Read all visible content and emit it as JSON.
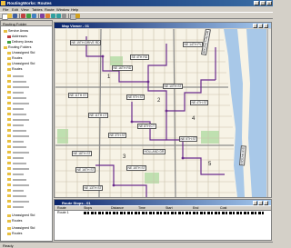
{
  "window": {
    "title": "RoutingWorks: Routes"
  },
  "menu": [
    "File",
    "Edit",
    "View",
    "Tables",
    "Route",
    "Window",
    "Help"
  ],
  "left_pane": {
    "header": "Routing Folder",
    "items": [
      {
        "label": "Service Areas",
        "indent": 1,
        "icon": "folder-icon"
      },
      {
        "label": "Addresses",
        "indent": 2,
        "icon": "layer-icon"
      },
      {
        "label": "Delivery Areas",
        "indent": 2,
        "icon": "layer-icon"
      },
      {
        "label": "Routing Folders",
        "indent": 1,
        "icon": "folder-icon"
      },
      {
        "label": "Unassigned Std",
        "indent": 2,
        "icon": "folder-icon"
      },
      {
        "label": "Routes",
        "indent": 2,
        "icon": "folder-icon"
      },
      {
        "label": "Unassigned Std",
        "indent": 2,
        "icon": "folder-icon"
      },
      {
        "label": "Routes",
        "indent": 2,
        "icon": "folder-icon"
      }
    ],
    "bottom_items": [
      {
        "label": "Unassigned Std",
        "indent": 2,
        "icon": "folder-icon"
      },
      {
        "label": "Routes",
        "indent": 2,
        "icon": "folder-icon"
      },
      {
        "label": "Unassigned Std",
        "indent": 2,
        "icon": "folder-icon"
      },
      {
        "label": "Routes",
        "indent": 2,
        "icon": "folder-icon"
      }
    ]
  },
  "map_window": {
    "title": "Map Viewer - 01",
    "labels": [
      {
        "text": "NE 19TH DRIVE RD"
      },
      {
        "text": "SE 4TH RD"
      },
      {
        "text": "NE 16TH RD"
      },
      {
        "text": "NE 14TH PL"
      },
      {
        "text": "NE 11TH ST"
      },
      {
        "text": "NE 9TH ST"
      },
      {
        "text": "NE 11TH CT"
      },
      {
        "text": "NE 8TH CT"
      },
      {
        "text": "NE 10TH ST"
      },
      {
        "text": "NE 4TH ST"
      },
      {
        "text": "NE 3TH ST"
      },
      {
        "text": "NE 18TH ST"
      },
      {
        "text": "HOLLAND DR"
      },
      {
        "text": "NE 5TH ST"
      },
      {
        "text": "NE 16TH ST"
      },
      {
        "text": "NE 15TH ST"
      },
      {
        "text": "NE 13TH ST"
      },
      {
        "text": "ARLINGTON DR"
      },
      {
        "text": "OCEAN AVE"
      }
    ],
    "region_numbers": [
      "1",
      "2",
      "3",
      "4",
      "5"
    ]
  },
  "grid_window": {
    "title": "Route Stops - 01",
    "columns": [
      "Route",
      "Stops",
      "Distance",
      "Time",
      "Start",
      "End",
      "Cost"
    ],
    "rows": [
      [
        "Route 1"
      ]
    ]
  },
  "status": {
    "text": "Ready"
  },
  "colors": {
    "route": "#6a2a8c",
    "water": "#a8c8e8",
    "map_bg": "#f7f3e6"
  }
}
